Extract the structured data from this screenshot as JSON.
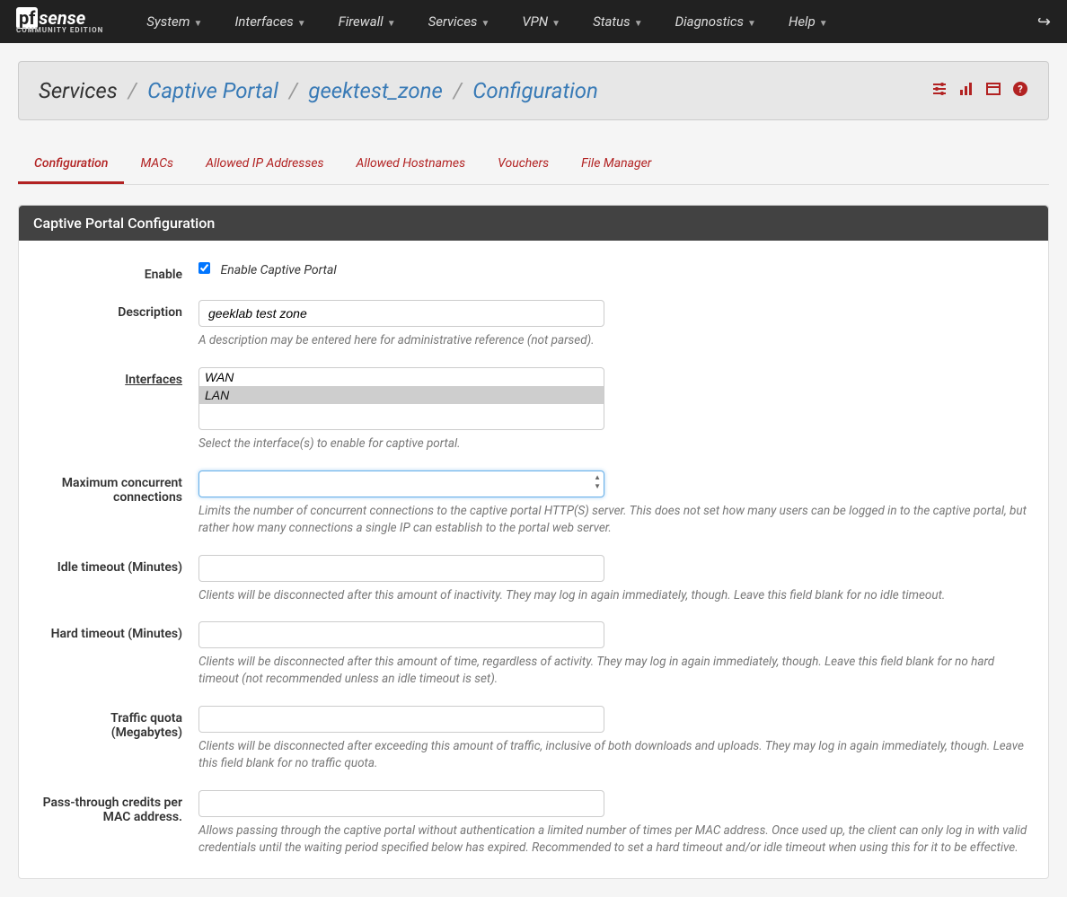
{
  "logo": {
    "brand": "sense",
    "prefix": "pf",
    "subtitle": "COMMUNITY EDITION"
  },
  "nav": {
    "items": [
      "System",
      "Interfaces",
      "Firewall",
      "Services",
      "VPN",
      "Status",
      "Diagnostics",
      "Help"
    ]
  },
  "breadcrumb": {
    "root": "Services",
    "link1": "Captive Portal",
    "link2": "geektest_zone",
    "current": "Configuration"
  },
  "tabs": [
    "Configuration",
    "MACs",
    "Allowed IP Addresses",
    "Allowed Hostnames",
    "Vouchers",
    "File Manager"
  ],
  "activeTab": 0,
  "panel": {
    "title": "Captive Portal Configuration"
  },
  "fields": {
    "enable": {
      "label": "Enable",
      "checkbox_label": "Enable Captive Portal",
      "checked": true
    },
    "description": {
      "label": "Description",
      "value": "geeklab test zone",
      "help": "A description may be entered here for administrative reference (not parsed)."
    },
    "interfaces": {
      "label": "Interfaces",
      "options": [
        "WAN",
        "LAN"
      ],
      "selected": "LAN",
      "help": "Select the interface(s) to enable for captive portal."
    },
    "maxconn": {
      "label": "Maximum concurrent connections",
      "value": "",
      "help": "Limits the number of concurrent connections to the captive portal HTTP(S) server. This does not set how many users can be logged in to the captive portal, but rather how many connections a single IP can establish to the portal web server."
    },
    "idle": {
      "label": "Idle timeout (Minutes)",
      "value": "",
      "help": "Clients will be disconnected after this amount of inactivity. They may log in again immediately, though. Leave this field blank for no idle timeout."
    },
    "hard": {
      "label": "Hard timeout (Minutes)",
      "value": "",
      "help": "Clients will be disconnected after this amount of time, regardless of activity. They may log in again immediately, though. Leave this field blank for no hard timeout (not recommended unless an idle timeout is set)."
    },
    "quota": {
      "label": "Traffic quota (Megabytes)",
      "value": "",
      "help": "Clients will be disconnected after exceeding this amount of traffic, inclusive of both downloads and uploads. They may log in again immediately, though. Leave this field blank for no traffic quota."
    },
    "passthru": {
      "label": "Pass-through credits per MAC address.",
      "value": "",
      "help": "Allows passing through the captive portal without authentication a limited number of times per MAC address. Once used up, the client can only log in with valid credentials until the waiting period specified below has expired. Recommended to set a hard timeout and/or idle timeout when using this for it to be effective."
    }
  }
}
